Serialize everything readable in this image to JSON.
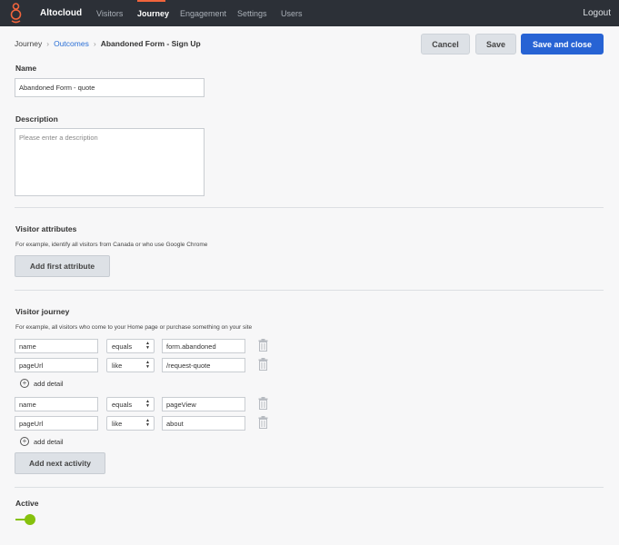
{
  "nav": {
    "brand": "Altocloud",
    "items": [
      "Visitors",
      "Journey",
      "Engagement",
      "Settings",
      "Users"
    ],
    "logout": "Logout",
    "accent_color": "#f0643c"
  },
  "breadcrumb": {
    "root": "Journey",
    "parent": "Outcomes",
    "current": "Abandoned Form - Sign Up"
  },
  "actions": {
    "cancel": "Cancel",
    "save": "Save",
    "save_close": "Save and close"
  },
  "form": {
    "name_label": "Name",
    "name_value": "Abandoned Form - quote",
    "description_label": "Description",
    "description_placeholder": "Please enter a description"
  },
  "visitor_attributes": {
    "title": "Visitor attributes",
    "hint": "For example, identify all visitors from Canada or who use Google Chrome",
    "add_button": "Add first attribute"
  },
  "visitor_journey": {
    "title": "Visitor journey",
    "hint": "For example, all visitors who come to your Home page or purchase something on your site",
    "activities": [
      {
        "rows": [
          {
            "field": "name",
            "operator": "equals",
            "value": "form.abandoned"
          },
          {
            "field": "pageUrl",
            "operator": "like",
            "value": "/request-quote"
          }
        ],
        "add_detail": "add detail"
      },
      {
        "rows": [
          {
            "field": "name",
            "operator": "equals",
            "value": "pageView"
          },
          {
            "field": "pageUrl",
            "operator": "like",
            "value": "about"
          }
        ],
        "add_detail": "add detail"
      }
    ],
    "add_next": "Add next activity"
  },
  "active": {
    "label": "Active",
    "on": true,
    "color": "#86c10d"
  }
}
